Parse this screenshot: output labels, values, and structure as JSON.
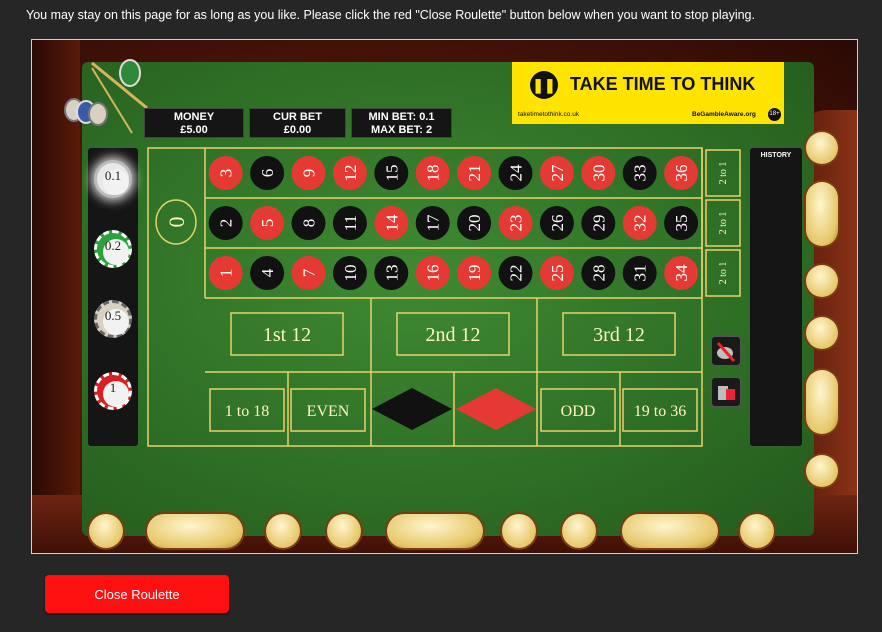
{
  "page": {
    "instructions": "You may stay on this page for as long as you like. Please click the red \"Close Roulette\" button below when you want to stop playing.",
    "close_button": "Close Roulette"
  },
  "displays": {
    "money_label": "MONEY",
    "money_value": "£5.00",
    "cur_bet_label": "CUR BET",
    "cur_bet_value": "£0.00",
    "min_bet": "MIN BET: 0.1",
    "max_bet": "MAX BET: 2"
  },
  "banner": {
    "headline": "TAKE TIME TO THINK",
    "url": "taketimetothink.co.uk",
    "aware": "BeGambleAware.org",
    "age": "18+"
  },
  "chips": [
    {
      "value": "0.1",
      "color": "#e8e8e8",
      "selected": true
    },
    {
      "value": "0.2",
      "color": "#2aa33a",
      "selected": false
    },
    {
      "value": "0.5",
      "color": "#d8d0c0",
      "selected": false
    },
    {
      "value": "1",
      "color": "#d82020",
      "selected": false
    }
  ],
  "table": {
    "zero": "0",
    "rows": [
      [
        3,
        6,
        9,
        12,
        15,
        18,
        21,
        24,
        27,
        30,
        33,
        36
      ],
      [
        2,
        5,
        8,
        11,
        14,
        17,
        20,
        23,
        26,
        29,
        32,
        35
      ],
      [
        1,
        4,
        7,
        10,
        13,
        16,
        19,
        22,
        25,
        28,
        31,
        34
      ]
    ],
    "red_numbers": [
      1,
      3,
      5,
      7,
      9,
      12,
      14,
      16,
      18,
      19,
      21,
      23,
      25,
      27,
      30,
      32,
      34,
      36
    ],
    "column_bets": [
      "2 to 1",
      "2 to 1",
      "2 to 1"
    ],
    "dozens": [
      "1st  12",
      "2nd  12",
      "3rd  12"
    ],
    "even_money": [
      "1 to 18",
      "EVEN",
      "ODD",
      "19 to 36"
    ],
    "colors": {
      "red": "#e43a33",
      "black": "#111111",
      "felt_line": "#e6d36a"
    }
  },
  "history": {
    "title": "HISTORY"
  }
}
